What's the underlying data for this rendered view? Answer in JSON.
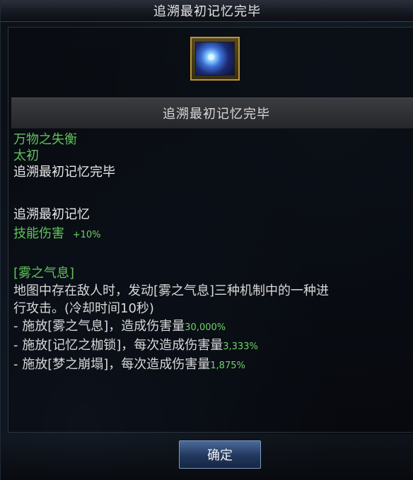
{
  "window": {
    "title": "追溯最初记忆完毕"
  },
  "item": {
    "icon_name": "memory-skill-icon",
    "name": "追溯最初记忆完毕",
    "category": "万物之失衡",
    "sub_category": "太初",
    "subtitle": "追溯最初记忆完毕",
    "effect_title": "追溯最初记忆",
    "stat_label": "技能伤害",
    "stat_value": "+10%",
    "skill_name": "[雾之气息]",
    "description_line1": "地图中存在敌人时，发动[雾之气息]三种机制中的一种进",
    "description_line2": "行攻击。(冷却时间10秒)",
    "mechanics": [
      {
        "label": "- 施放[雾之气息]，造成伤害量",
        "value": "30,000%"
      },
      {
        "label": "- 施放[记忆之枷锁]，每次造成伤害量",
        "value": "3,333%"
      },
      {
        "label": "- 施放[梦之崩塌]，每次造成伤害量",
        "value": "1,875%"
      }
    ]
  },
  "footer": {
    "confirm_label": "确定"
  },
  "colors": {
    "green_text": "#5fc45a",
    "gold_border": "#b8953a",
    "button_blue": "#22385e"
  }
}
